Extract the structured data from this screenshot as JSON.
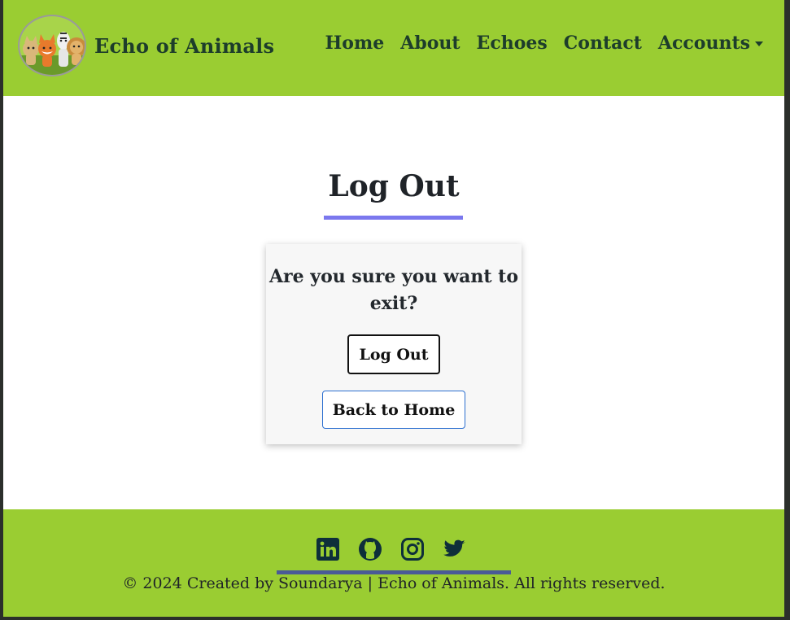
{
  "navbar": {
    "brand_name": "Echo of Animals",
    "items": [
      {
        "label": "Home"
      },
      {
        "label": "About"
      },
      {
        "label": "Echoes"
      },
      {
        "label": "Contact"
      },
      {
        "label": "Accounts"
      }
    ],
    "background": "#9acd32",
    "text_color": "#1d3d2b"
  },
  "main": {
    "title": "Log Out",
    "underline_color": "#7b78ee",
    "card": {
      "question": "Are you sure you want to exit?",
      "logout_label": "Log Out",
      "home_label": "Back to Home"
    }
  },
  "footer": {
    "socials": [
      {
        "icon": "linkedin-icon"
      },
      {
        "icon": "github-icon"
      },
      {
        "icon": "instagram-icon"
      },
      {
        "icon": "twitter-icon"
      }
    ],
    "copyright": "© 2024 Created by Soundarya | Echo of Animals. All rights reserved.",
    "background": "#9acd32",
    "bar_color": "#4a5a96"
  }
}
